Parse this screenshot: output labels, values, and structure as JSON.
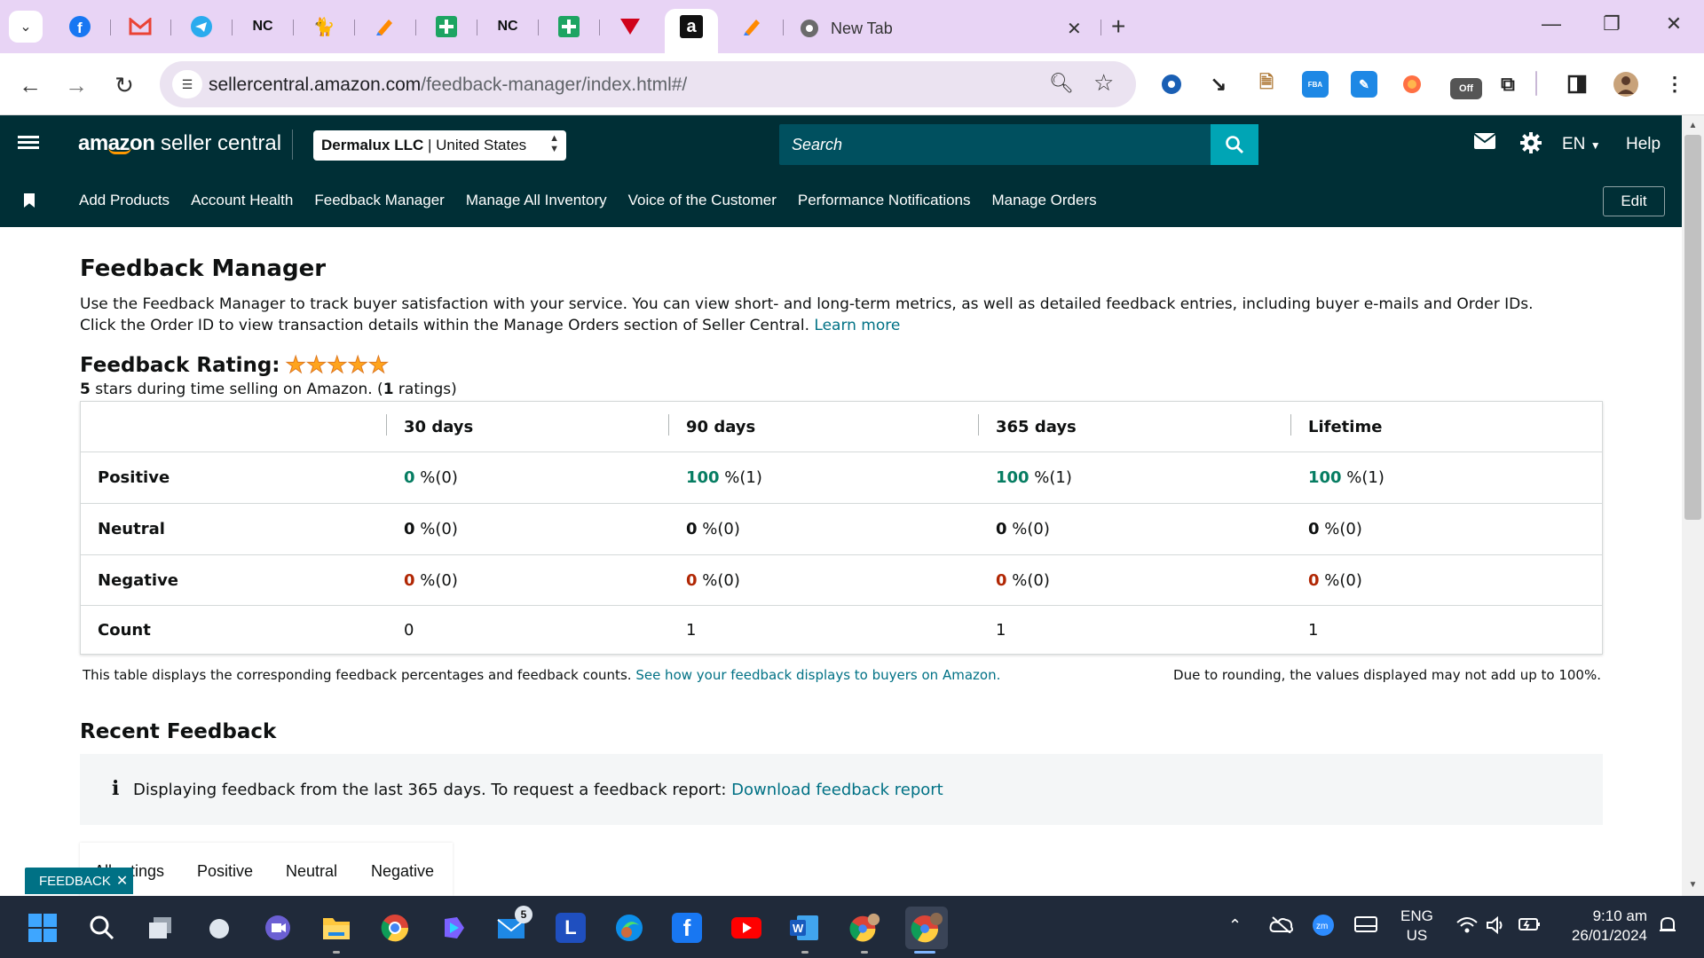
{
  "browser": {
    "tab_icons": [
      "facebook-icon",
      "gmail-icon",
      "telegram-icon",
      "nc-icon",
      "black-cat-icon",
      "pen-icon",
      "green-plus-icon",
      "nc-icon",
      "green-plus-icon",
      "red-triangle-icon",
      "amazon-icon",
      "pen-icon"
    ],
    "tab_labels": {
      "nc1": "NC",
      "nc2": "NC",
      "amazon": "a"
    },
    "newtab_title": "New Tab",
    "url_host": "sellercentral.amazon.com",
    "url_path": "/feedback-manager/index.html#/",
    "ext_labels": {
      "fba": "FBA",
      "off": "Off"
    }
  },
  "header": {
    "logo_brand": "amazon",
    "logo_product": "seller central",
    "account_name": "Dermalux LLC",
    "account_sep": " | ",
    "account_region": "United States",
    "search_placeholder": "Search",
    "lang": "EN",
    "help": "Help"
  },
  "nav": {
    "links": [
      "Add Products",
      "Account Health",
      "Feedback Manager",
      "Manage All Inventory",
      "Voice of the Customer",
      "Performance Notifications",
      "Manage Orders"
    ],
    "edit": "Edit"
  },
  "page": {
    "title": "Feedback Manager",
    "intro_line1": "Use the Feedback Manager to track buyer satisfaction with your service. You can view short- and long-term metrics, as well as detailed feedback entries, including buyer e-mails and Order IDs.",
    "intro_line2": "Click the Order ID to view transaction details within the Manage Orders section of Seller Central.",
    "learn_more": "Learn more",
    "rating_label": "Feedback Rating:",
    "rating_stars": 5,
    "rating_sub_stars": "5",
    "rating_sub_text1": " stars during time selling on Amazon. (",
    "rating_sub_count": "1",
    "rating_sub_text2": " ratings)"
  },
  "table": {
    "columns": [
      "30 days",
      "90 days",
      "365 days",
      "Lifetime"
    ],
    "rows": [
      {
        "label": "Positive",
        "cells": [
          {
            "num": "0",
            "rest": " %(0)",
            "tone": "green"
          },
          {
            "num": "100",
            "rest": " %(1)",
            "tone": "green"
          },
          {
            "num": "100",
            "rest": " %(1)",
            "tone": "green"
          },
          {
            "num": "100",
            "rest": " %(1)",
            "tone": "green"
          }
        ]
      },
      {
        "label": "Neutral",
        "cells": [
          {
            "num": "0",
            "rest": " %(0)",
            "tone": "plain"
          },
          {
            "num": "0",
            "rest": " %(0)",
            "tone": "plain"
          },
          {
            "num": "0",
            "rest": " %(0)",
            "tone": "plain"
          },
          {
            "num": "0",
            "rest": " %(0)",
            "tone": "plain"
          }
        ]
      },
      {
        "label": "Negative",
        "cells": [
          {
            "num": "0",
            "rest": " %(0)",
            "tone": "red"
          },
          {
            "num": "0",
            "rest": " %(0)",
            "tone": "red"
          },
          {
            "num": "0",
            "rest": " %(0)",
            "tone": "red"
          },
          {
            "num": "0",
            "rest": " %(0)",
            "tone": "red"
          }
        ]
      },
      {
        "label": "Count",
        "cells": [
          {
            "num": "",
            "rest": "0",
            "tone": "none"
          },
          {
            "num": "",
            "rest": "1",
            "tone": "none"
          },
          {
            "num": "",
            "rest": "1",
            "tone": "none"
          },
          {
            "num": "",
            "rest": "1",
            "tone": "none"
          }
        ]
      }
    ],
    "note": "This table displays the corresponding feedback percentages and feedback counts.",
    "note_link": "See how your feedback displays to buyers on Amazon.",
    "note_right": "Due to rounding, the values displayed may not add up to 100%."
  },
  "recent": {
    "title": "Recent Feedback",
    "info_icon": "i",
    "info_text": "Displaying feedback from the last 365 days. To request a feedback report:",
    "info_link": "Download feedback report",
    "tabs": [
      "All ratings",
      "Positive",
      "Neutral",
      "Negative"
    ]
  },
  "feedback_badge": "FEEDBACK",
  "taskbar": {
    "mail_badge": "5",
    "l_label": "L",
    "lang_top": "ENG",
    "lang_bottom": "US",
    "time": "9:10 am",
    "date": "26/01/2024"
  },
  "colors": {
    "header_bg": "#002f36",
    "search_bg": "#00505f",
    "search_btn": "#00a5b5",
    "link": "#007185",
    "positive": "#067d62",
    "negative": "#b12704",
    "star": "#ffa41c",
    "tabstrip": "#e8d4f5"
  }
}
